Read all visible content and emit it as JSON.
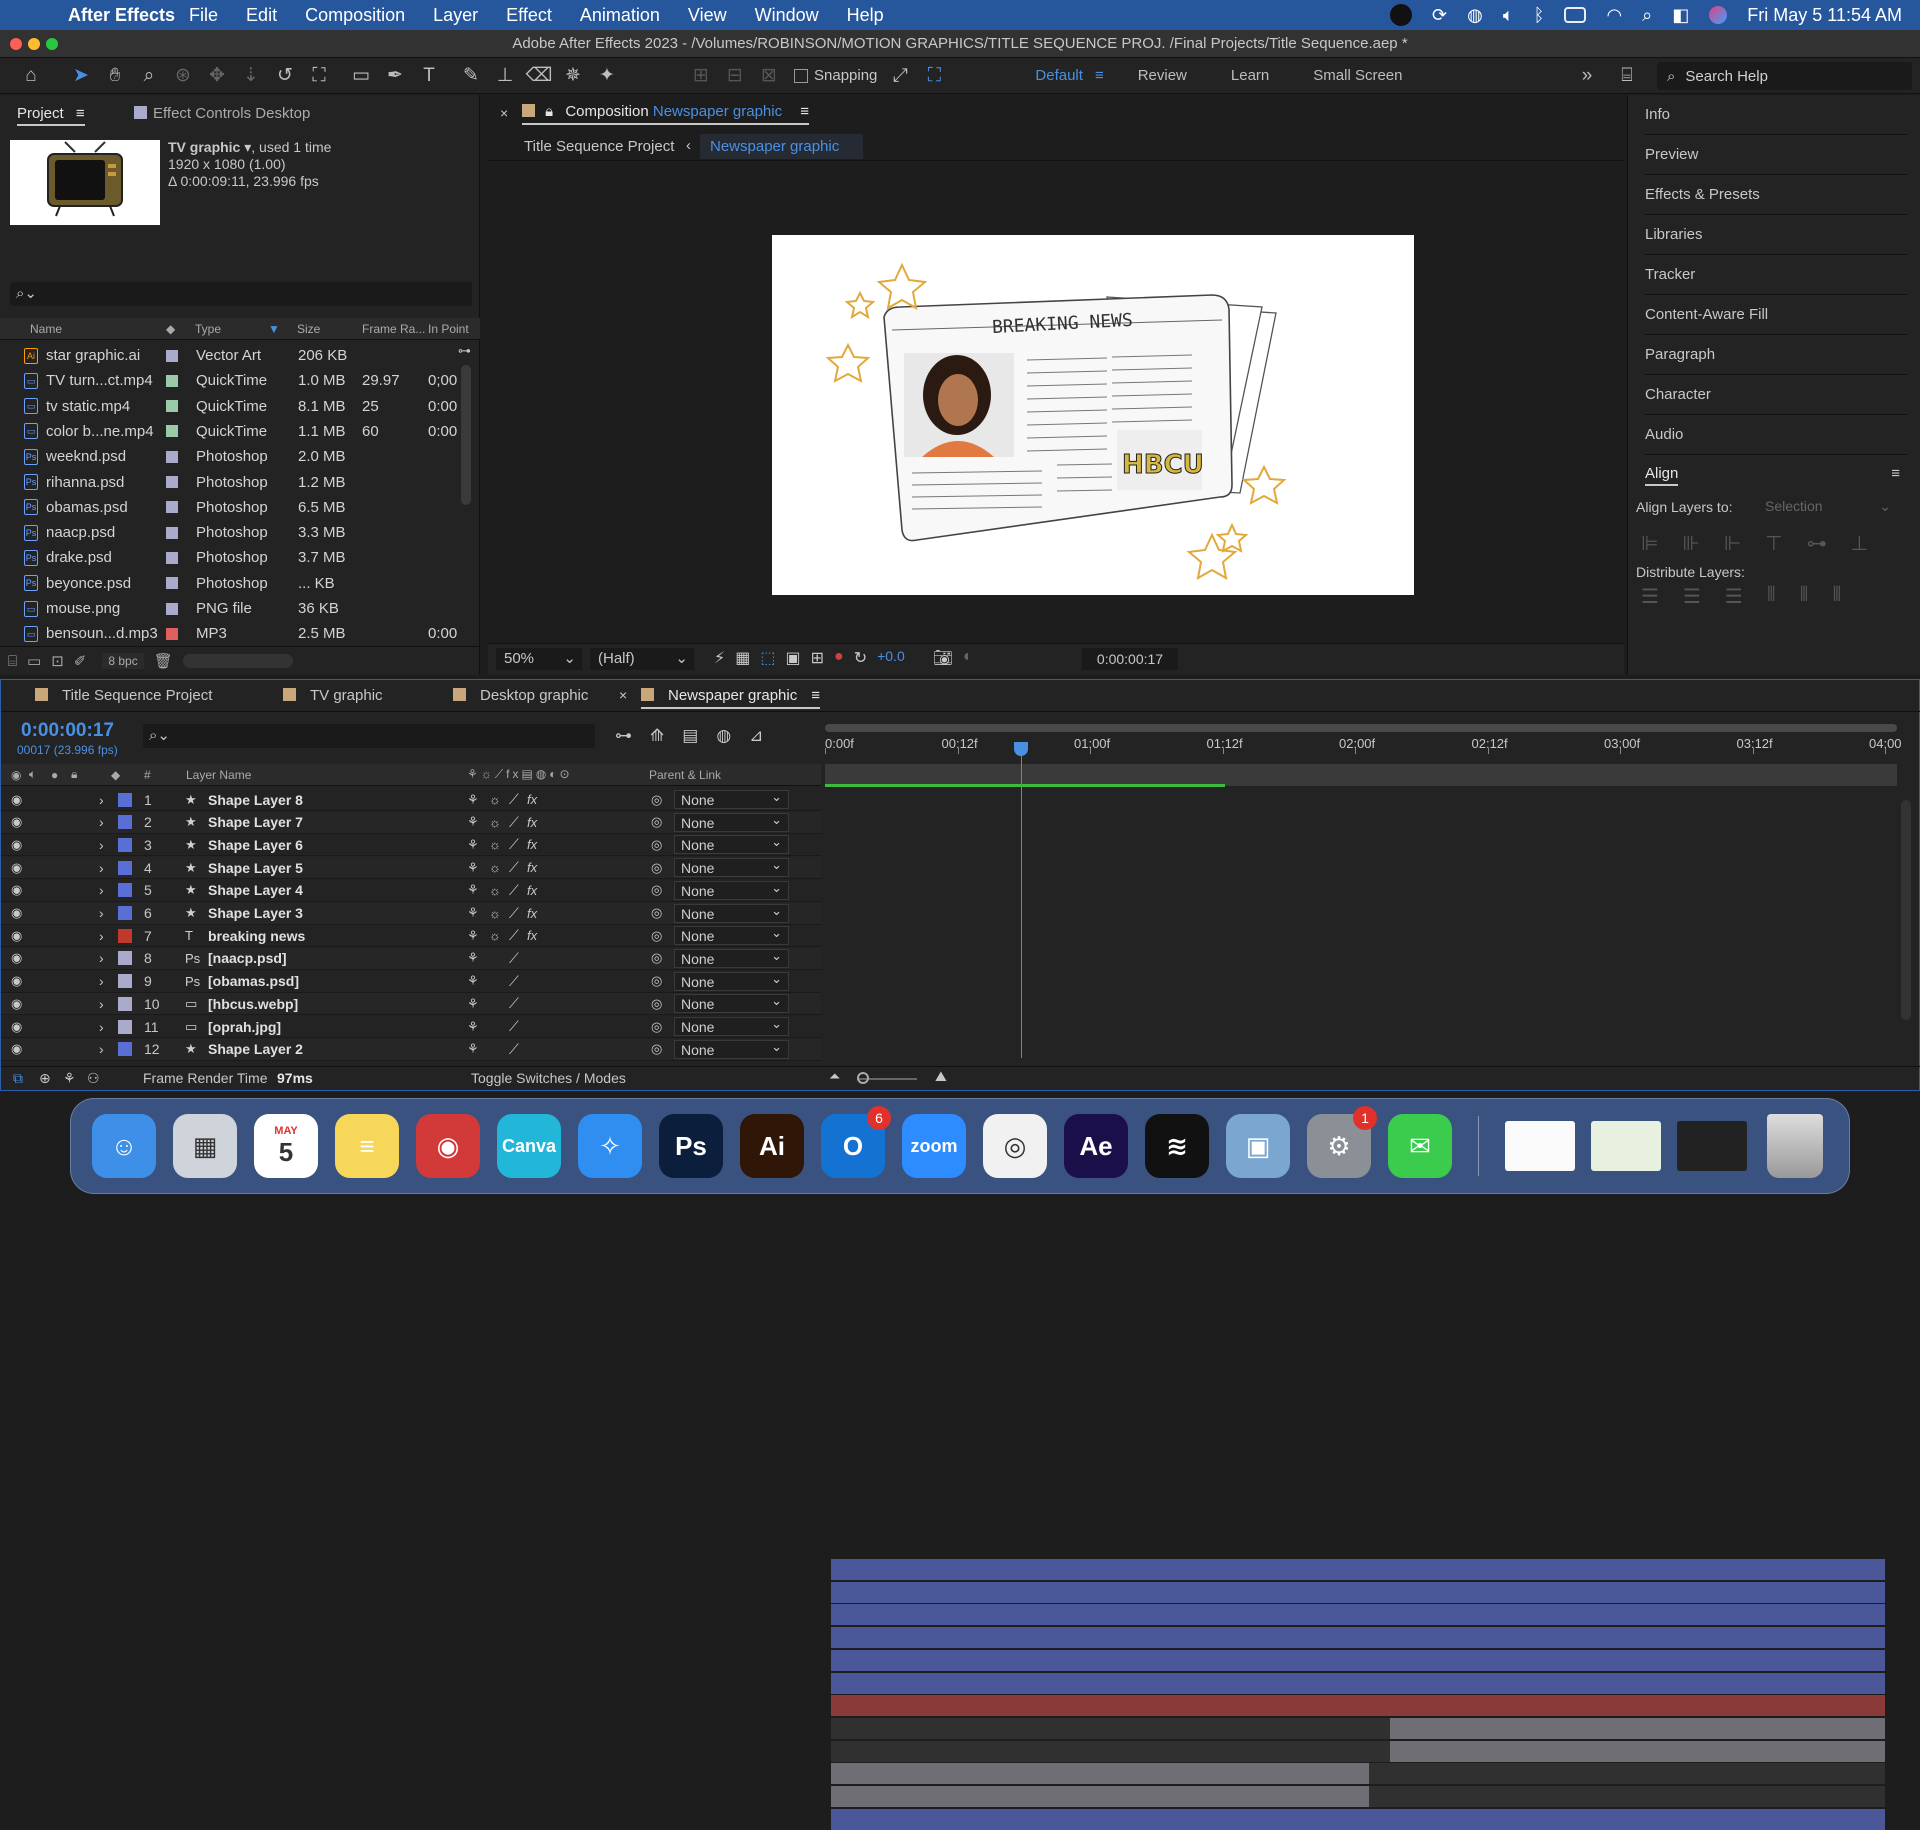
{
  "menubar": {
    "app": "After Effects",
    "items": [
      "File",
      "Edit",
      "Composition",
      "Layer",
      "Effect",
      "Animation",
      "View",
      "Window",
      "Help"
    ],
    "clock": "Fri May 5  11:54 AM"
  },
  "window": {
    "title": "Adobe After Effects 2023 - /Volumes/ROBINSON/MOTION GRAPHICS/TITLE SEQUENCE PROJ. /Final Projects/Title Sequence.aep *"
  },
  "toolbar": {
    "snapping": "Snapping",
    "workspaces": [
      "Default",
      "Review",
      "Learn",
      "Small Screen"
    ],
    "search_help": "Search Help"
  },
  "project": {
    "tab": "Project",
    "tab2": "Effect Controls Desktop",
    "selected_name": "TV graphic",
    "used": ", used 1 time",
    "dims": "1920 x 1080 (1.00)",
    "duration": "Δ 0:00:09:11, 23.996 fps",
    "columns": [
      "Name",
      "Type",
      "Size",
      "Frame Ra...",
      "In Point"
    ],
    "items": [
      {
        "name": "star graphic.ai",
        "type": "Vector Art",
        "size": "206 KB",
        "fr": "",
        "in": "",
        "icon": "Ai",
        "color": "#aaaacc"
      },
      {
        "name": "TV turn...ct.mp4",
        "type": "QuickTime",
        "size": "1.0 MB",
        "fr": "29.97",
        "in": "0;00",
        "icon": "▭",
        "color": "#9ccaa8"
      },
      {
        "name": "tv static.mp4",
        "type": "QuickTime",
        "size": "8.1 MB",
        "fr": "25",
        "in": "0:00",
        "icon": "▭",
        "color": "#9ccaa8"
      },
      {
        "name": "color b...ne.mp4",
        "type": "QuickTime",
        "size": "1.1 MB",
        "fr": "60",
        "in": "0:00",
        "icon": "▭",
        "color": "#9ccaa8"
      },
      {
        "name": "weeknd.psd",
        "type": "Photoshop",
        "size": "2.0 MB",
        "fr": "",
        "in": "",
        "icon": "Ps",
        "color": "#aaaacc"
      },
      {
        "name": "rihanna.psd",
        "type": "Photoshop",
        "size": "1.2 MB",
        "fr": "",
        "in": "",
        "icon": "Ps",
        "color": "#aaaacc"
      },
      {
        "name": "obamas.psd",
        "type": "Photoshop",
        "size": "6.5 MB",
        "fr": "",
        "in": "",
        "icon": "Ps",
        "color": "#aaaacc"
      },
      {
        "name": "naacp.psd",
        "type": "Photoshop",
        "size": "3.3 MB",
        "fr": "",
        "in": "",
        "icon": "Ps",
        "color": "#aaaacc"
      },
      {
        "name": "drake.psd",
        "type": "Photoshop",
        "size": "3.7 MB",
        "fr": "",
        "in": "",
        "icon": "Ps",
        "color": "#aaaacc"
      },
      {
        "name": "beyonce.psd",
        "type": "Photoshop",
        "size": "... KB",
        "fr": "",
        "in": "",
        "icon": "Ps",
        "color": "#aaaacc"
      },
      {
        "name": "mouse.png",
        "type": "PNG file",
        "size": "36 KB",
        "fr": "",
        "in": "",
        "icon": "▭",
        "color": "#aaaacc"
      },
      {
        "name": "bensoun...d.mp3",
        "type": "MP3",
        "size": "2.5 MB",
        "fr": "",
        "in": "0:00",
        "icon": "▭",
        "color": "#e06060"
      }
    ],
    "bpc": "8 bpc"
  },
  "composition": {
    "tab_prefix": "Composition",
    "tab_name": "Newspaper graphic",
    "crumb1": "Title Sequence Project",
    "crumb2": "Newspaper graphic",
    "zoom": "50%",
    "quality": "(Half)",
    "exposure": "+0.0",
    "timecode": "0:00:00:17",
    "headline": "BREAKING NEWS",
    "badge": "HBCU"
  },
  "right_panels": [
    "Info",
    "Preview",
    "Effects & Presets",
    "Libraries",
    "Tracker",
    "Content-Aware Fill",
    "Paragraph",
    "Character",
    "Audio"
  ],
  "align": {
    "title": "Align",
    "layers_to": "Align Layers to:",
    "selection": "Selection",
    "distribute": "Distribute Layers:"
  },
  "timeline": {
    "tabs": [
      "Title Sequence Project",
      "TV graphic",
      "Desktop graphic",
      "Newspaper graphic"
    ],
    "timecode": "0:00:00:17",
    "fps": "00017 (23.996 fps)",
    "ruler": [
      "0:00f",
      "00:12f",
      "01:00f",
      "01:12f",
      "02:00f",
      "02:12f",
      "03:00f",
      "03:12f",
      "04:00"
    ],
    "col_layer": "Layer Name",
    "col_num": "#",
    "col_parent": "Parent & Link",
    "layers": [
      {
        "n": "1",
        "name": "Shape Layer 8",
        "kind": "★",
        "color": "#5a6fd6",
        "fx": true,
        "parent": "None",
        "start": 0,
        "end": 1,
        "bar": "#4a5899"
      },
      {
        "n": "2",
        "name": "Shape Layer 7",
        "kind": "★",
        "color": "#5a6fd6",
        "fx": true,
        "parent": "None",
        "start": 0,
        "end": 1,
        "bar": "#4a5899"
      },
      {
        "n": "3",
        "name": "Shape Layer 6",
        "kind": "★",
        "color": "#5a6fd6",
        "fx": true,
        "parent": "None",
        "start": 0,
        "end": 1,
        "bar": "#4a5899"
      },
      {
        "n": "4",
        "name": "Shape Layer 5",
        "kind": "★",
        "color": "#5a6fd6",
        "fx": true,
        "parent": "None",
        "start": 0,
        "end": 1,
        "bar": "#4a5899"
      },
      {
        "n": "5",
        "name": "Shape Layer 4",
        "kind": "★",
        "color": "#5a6fd6",
        "fx": true,
        "parent": "None",
        "start": 0,
        "end": 1,
        "bar": "#4a5899"
      },
      {
        "n": "6",
        "name": "Shape Layer 3",
        "kind": "★",
        "color": "#5a6fd6",
        "fx": true,
        "parent": "None",
        "start": 0,
        "end": 1,
        "bar": "#4a5899"
      },
      {
        "n": "7",
        "name": "breaking news",
        "kind": "T",
        "color": "#c0392b",
        "fx": true,
        "parent": "None",
        "start": 0,
        "end": 1,
        "bar": "#8b3a3a"
      },
      {
        "n": "8",
        "name": "[naacp.psd]",
        "kind": "Ps",
        "color": "#aaaacc",
        "fx": false,
        "parent": "None",
        "start": 0.53,
        "end": 1,
        "bar": "#6e6e74"
      },
      {
        "n": "9",
        "name": "[obamas.psd]",
        "kind": "Ps",
        "color": "#aaaacc",
        "fx": false,
        "parent": "None",
        "start": 0.53,
        "end": 1,
        "bar": "#6e6e74"
      },
      {
        "n": "10",
        "name": "[hbcus.webp]",
        "kind": "▭",
        "color": "#aaaacc",
        "fx": false,
        "parent": "None",
        "start": 0,
        "end": 0.51,
        "bar": "#6e6e74"
      },
      {
        "n": "11",
        "name": "[oprah.jpg]",
        "kind": "▭",
        "color": "#aaaacc",
        "fx": false,
        "parent": "None",
        "start": 0,
        "end": 0.51,
        "bar": "#6e6e74"
      },
      {
        "n": "12",
        "name": "Shape Layer 2",
        "kind": "★",
        "color": "#5a6fd6",
        "fx": false,
        "parent": "None",
        "start": 0,
        "end": 1,
        "bar": "#4a5899"
      }
    ],
    "playhead": 0.18,
    "frame_render_label": "Frame Render Time",
    "frame_render_value": "97ms",
    "toggle": "Toggle Switches / Modes"
  },
  "dock": [
    {
      "name": "Finder",
      "label": "☺",
      "bg": "#3d8fe8"
    },
    {
      "name": "Launchpad",
      "label": "▦",
      "bg": "#cfd3da"
    },
    {
      "name": "Calendar",
      "label": "5",
      "bg": "#ffffff",
      "month": "MAY"
    },
    {
      "name": "Notes",
      "label": "≡",
      "bg": "#f7d75a"
    },
    {
      "name": "Photo Booth",
      "label": "◉",
      "bg": "#d23a3a"
    },
    {
      "name": "Canva",
      "label": "Canva",
      "bg": "#22b6d8"
    },
    {
      "name": "Safari",
      "label": "✧",
      "bg": "#2f8ef0"
    },
    {
      "name": "Photoshop",
      "label": "Ps",
      "bg": "#0b1f3d"
    },
    {
      "name": "Illustrator",
      "label": "Ai",
      "bg": "#2f1606"
    },
    {
      "name": "Outlook",
      "label": "O",
      "bg": "#1473d2",
      "badge": "6"
    },
    {
      "name": "Zoom",
      "label": "zoom",
      "bg": "#2d8cff"
    },
    {
      "name": "Chrome",
      "label": "◎",
      "bg": "#f1f1f1"
    },
    {
      "name": "After Effects",
      "label": "Ae",
      "bg": "#1b0f4a"
    },
    {
      "name": "Spotify",
      "label": "≋",
      "bg": "#111111"
    },
    {
      "name": "Preview",
      "label": "▣",
      "bg": "#7aa6cf"
    },
    {
      "name": "System Settings",
      "label": "⚙",
      "bg": "#8b8f96",
      "badge": "1"
    },
    {
      "name": "Messages",
      "label": "✉",
      "bg": "#3ccc4d"
    }
  ]
}
